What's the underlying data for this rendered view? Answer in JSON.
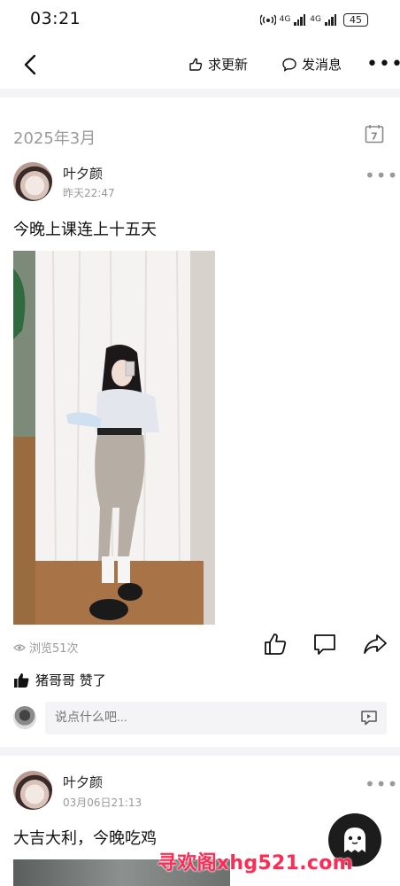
{
  "status_bar": {
    "time": "03:21",
    "network_1": "4G",
    "network_2": "4G",
    "battery": "45"
  },
  "nav": {
    "request_update_label": "求更新",
    "message_label": "发消息"
  },
  "feed": {
    "month_header": "2025年3月",
    "calendar_day": "7",
    "posts": [
      {
        "author": "叶夕颜",
        "time": "昨天22:47",
        "text": "今晚上课连上十五天",
        "views": "浏览51次",
        "like_summary": "猪哥哥 赞了",
        "comment_placeholder": "说点什么吧..."
      },
      {
        "author": "叶夕颜",
        "time": "03月06日21:13",
        "text": "大吉大利，今晚吃鸡"
      }
    ]
  },
  "watermark": "寻欢阁xhg521.com"
}
